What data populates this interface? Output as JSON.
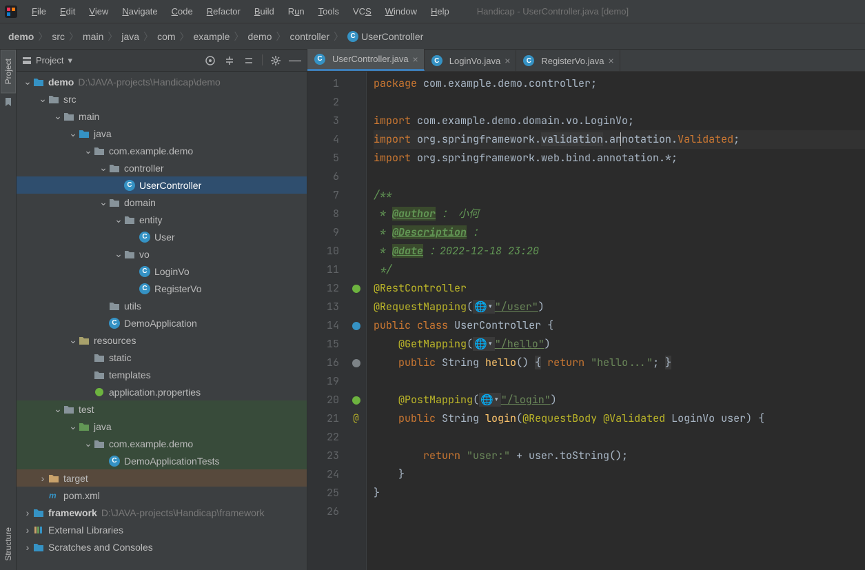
{
  "menu": {
    "items": [
      "File",
      "Edit",
      "View",
      "Navigate",
      "Code",
      "Refactor",
      "Build",
      "Run",
      "Tools",
      "VCS",
      "Window",
      "Help"
    ]
  },
  "window_title": "Handicap - UserController.java [demo]",
  "breadcrumbs": [
    "demo",
    "src",
    "main",
    "java",
    "com",
    "example",
    "demo",
    "controller",
    "UserController"
  ],
  "sidebar_tabs": {
    "project": "Project",
    "structure": "Structure"
  },
  "panel": {
    "title": "Project"
  },
  "tree": {
    "demo": "demo",
    "demo_path": "D:\\JAVA-projects\\Handicap\\demo",
    "src": "src",
    "main": "main",
    "java": "java",
    "pkg": "com.example.demo",
    "controller": "controller",
    "usercontroller": "UserController",
    "domain": "domain",
    "entity": "entity",
    "user": "User",
    "vo": "vo",
    "loginvo": "LoginVo",
    "registervo": "RegisterVo",
    "utils": "utils",
    "demoapp": "DemoApplication",
    "resources": "resources",
    "static": "static",
    "templates": "templates",
    "appprops": "application.properties",
    "test": "test",
    "test_java": "java",
    "test_pkg": "com.example.demo",
    "demotests": "DemoApplicationTests",
    "target": "target",
    "pom": "pom.xml",
    "framework": "framework",
    "framework_path": "D:\\JAVA-projects\\Handicap\\framework",
    "extlibs": "External Libraries",
    "scratches": "Scratches and Consoles"
  },
  "tabs": [
    {
      "label": "UserController.java",
      "active": true
    },
    {
      "label": "LoginVo.java",
      "active": false
    },
    {
      "label": "RegisterVo.java",
      "active": false
    }
  ],
  "line_numbers": [
    "1",
    "2",
    "3",
    "4",
    "5",
    "6",
    "7",
    "8",
    "9",
    "10",
    "11",
    "12",
    "13",
    "14",
    "15",
    "16",
    "19",
    "20",
    "21",
    "22",
    "23",
    "24",
    "25",
    "26"
  ],
  "code": {
    "l1": {
      "kw": "package",
      "rest": " com.example.demo.controller;"
    },
    "l3": {
      "kw": "import",
      "rest": " com.example.demo.domain.vo.LoginVo;"
    },
    "l4": {
      "kw": "import",
      "p1": " org.springframework.",
      "hl": "validation",
      "p2": ".annotation.",
      "cls": "Validated",
      "semi": ";"
    },
    "l5": {
      "kw": "import",
      "rest": " org.springframework.web.bind.annotation.*;"
    },
    "l7": "/**",
    "l8a": " * ",
    "l8tag": "@author",
    "l8b": " ：",
    "l8c": " 小何",
    "l9a": " * ",
    "l9tag": "@Description",
    "l9b": " ：",
    "l10a": " * ",
    "l10tag": "@date",
    "l10b": " ：",
    "l10c": "2022-12-18 23:20",
    "l11": " */",
    "l12": "@RestController",
    "l13a": "@RequestMapping",
    "l13b": "(",
    "l13s": "\"/user\"",
    "l13c": ")",
    "l14kw1": "public",
    "l14kw2": "class",
    "l14name": "UserController",
    "l14b": " {",
    "l15a": "    @GetMapping",
    "l15b": "(",
    "l15s": "\"/hello\"",
    "l15c": ")",
    "l16kw": "    public ",
    "l16t": "String ",
    "l16fn": "hello",
    "l16b": "() ",
    "l16br1": "{",
    "l16ret": " return ",
    "l16s": "\"hello...\"",
    "l16semi": "; ",
    "l16br2": "}",
    "l20a": "    @PostMapping",
    "l20b": "(",
    "l20s": "\"/login\"",
    "l20c": ")",
    "l21kw": "    public ",
    "l21t": "String ",
    "l21fn": "login",
    "l21p": "(",
    "l21a1": "@RequestBody ",
    "l21a2": "@Validated ",
    "l21pt": "LoginVo ",
    "l21pn": "user",
    "l21e": ") {",
    "l23a": "        ",
    "l23kw": "return ",
    "l23s": "\"user:\"",
    "l23b": " + user.toString();",
    "l24": "    }",
    "l25": "}"
  }
}
